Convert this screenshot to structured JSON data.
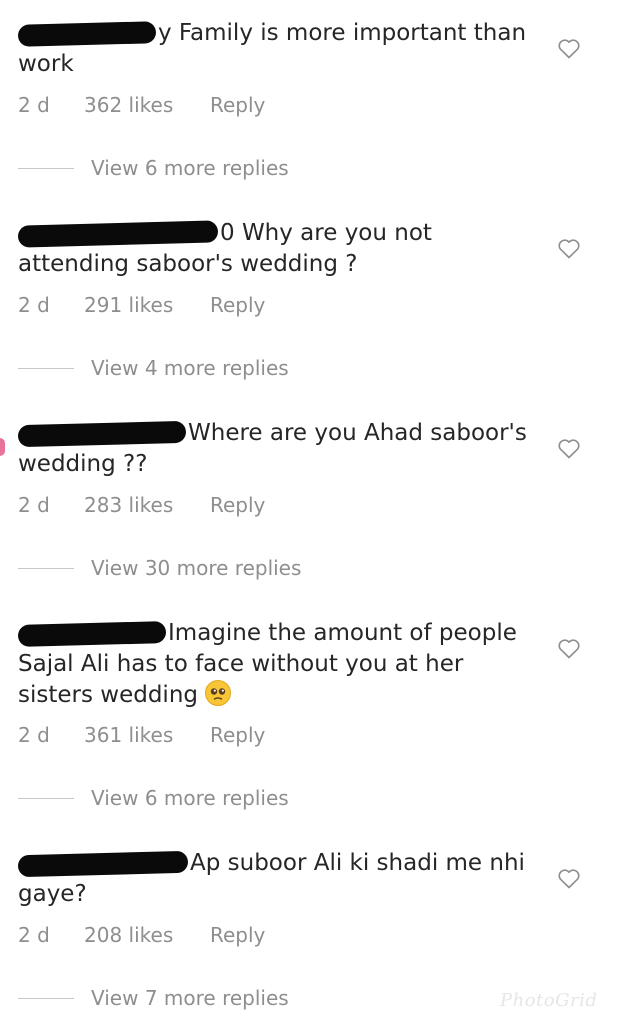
{
  "comments": [
    {
      "text": "y Family is more important than work",
      "age": "2 d",
      "likes": "362 likes",
      "reply": "Reply",
      "view_replies": "View 6 more replies"
    },
    {
      "text": "0 Why are you not attending saboor's wedding ?",
      "age": "2 d",
      "likes": "291 likes",
      "reply": "Reply",
      "view_replies": "View 4 more replies"
    },
    {
      "text": "Where are you Ahad saboor's wedding ??",
      "age": "2 d",
      "likes": "283 likes",
      "reply": "Reply",
      "view_replies": "View 30 more replies"
    },
    {
      "text": "Imagine the amount of people Sajal Ali has to face without you at her sisters wedding",
      "emoji": "pleading-face-emoji",
      "age": "2 d",
      "likes": "361 likes",
      "reply": "Reply",
      "view_replies": "View 6 more replies"
    },
    {
      "text": "Ap suboor Ali ki shadi me nhi gaye?",
      "age": "2 d",
      "likes": "208 likes",
      "reply": "Reply",
      "view_replies": "View 7 more replies"
    }
  ],
  "watermark": "PhotoGrid",
  "icons": {
    "like": "heart-outline-icon"
  },
  "colors": {
    "text": "#262626",
    "muted": "#8e8e8e",
    "redaction": "#0a0a0a"
  }
}
